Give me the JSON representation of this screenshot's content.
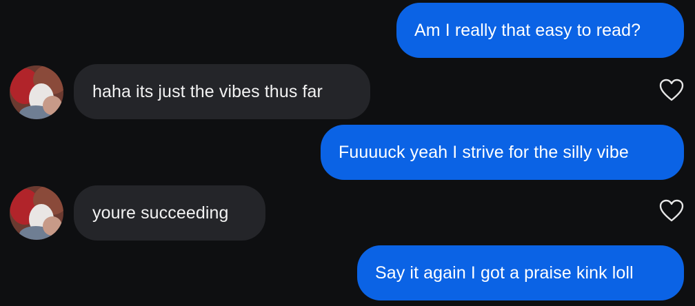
{
  "messages": [
    {
      "direction": "outgoing",
      "text": "Am I really that easy to read?"
    },
    {
      "direction": "incoming",
      "text": "haha its just the vibes thus far"
    },
    {
      "direction": "outgoing",
      "text": "Fuuuuck yeah I strive for the silly vibe"
    },
    {
      "direction": "incoming",
      "text": "youre succeeding"
    },
    {
      "direction": "outgoing",
      "text": "Say it again I got a praise kink loll"
    }
  ],
  "icons": {
    "avatar": "contact-avatar-icon",
    "like": "heart-outline-icon"
  },
  "colors": {
    "background": "#0e0f11",
    "outgoing_bubble": "#0b63e5",
    "incoming_bubble": "#242529",
    "text": "#ffffff",
    "heart_stroke": "#e6e6e6"
  }
}
